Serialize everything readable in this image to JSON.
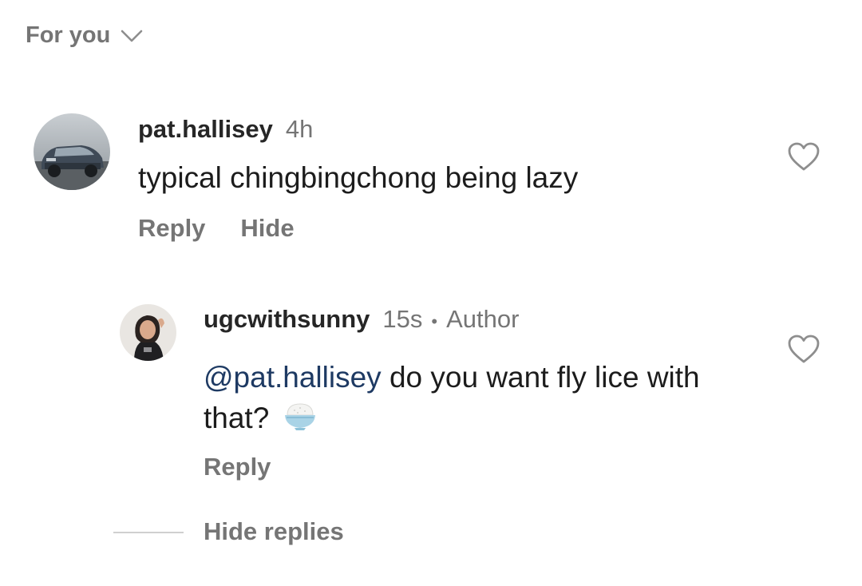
{
  "filter": {
    "label": "For you",
    "icon": "chevron-down-icon"
  },
  "comments": [
    {
      "username": "pat.hallisey",
      "time": "4h",
      "text": "typical chingbingchong being lazy",
      "avatar": "car-photo-avatar",
      "actions": [
        "Reply",
        "Hide"
      ],
      "like_icon": "heart-outline-icon"
    }
  ],
  "reply": {
    "username": "ugcwithsunny",
    "time": "15s",
    "separator": "•",
    "badge": "Author",
    "mention": "@pat.hallisey",
    "text": " do you want fly lice with that?",
    "emoji": "rice-bowl-emoji",
    "avatar": "person-photo-avatar",
    "actions": [
      "Reply"
    ],
    "like_icon": "heart-outline-icon"
  },
  "hide_replies_label": "Hide replies",
  "colors": {
    "text_primary": "#1c1c1c",
    "text_secondary": "#757575",
    "mention": "#1e3a63",
    "background": "#ffffff"
  }
}
